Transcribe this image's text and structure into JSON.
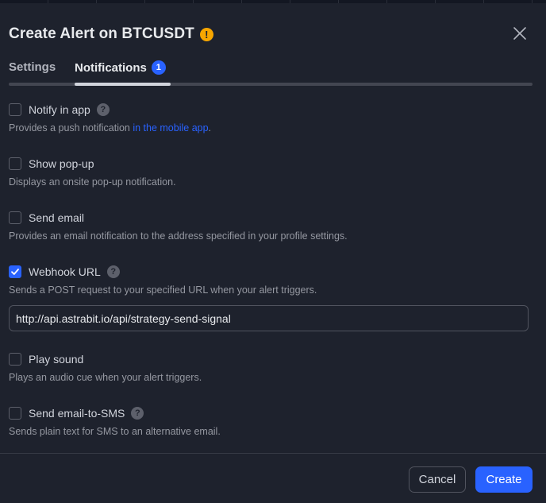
{
  "dialog": {
    "title": "Create Alert on BTCUSDT",
    "warning_icon": "exclamation-icon",
    "warning_symbol": "!",
    "close_icon": "close-icon"
  },
  "tabs": [
    {
      "label": "Settings",
      "active": false
    },
    {
      "label": "Notifications",
      "active": true,
      "badge": "1"
    }
  ],
  "options": [
    {
      "label": "Notify in app",
      "checked": false,
      "help": true,
      "description": "Provides a push notification ",
      "link": "in the mobile app",
      "description_end": "."
    },
    {
      "label": "Show pop-up",
      "checked": false,
      "description": "Displays an onsite pop-up notification."
    },
    {
      "label": "Send email",
      "checked": false,
      "description": "Provides an email notification to the address specified in your profile settings."
    },
    {
      "label": "Webhook URL",
      "checked": true,
      "help": true,
      "description": "Sends a POST request to your specified URL when your alert triggers."
    },
    {
      "label": "Play sound",
      "checked": false,
      "description": "Plays an audio cue when your alert triggers."
    },
    {
      "label": "Send email-to-SMS",
      "checked": false,
      "help": true,
      "description": "Sends plain text for SMS to an alternative email."
    }
  ],
  "help_symbol": "?",
  "webhook": {
    "value": "http://api.astrabit.io/api/strategy-send-signal"
  },
  "footer": {
    "cancel_label": "Cancel",
    "create_label": "Create"
  },
  "colors": {
    "accent": "#2962ff",
    "warning": "#f7a600",
    "background": "#1e222d"
  }
}
